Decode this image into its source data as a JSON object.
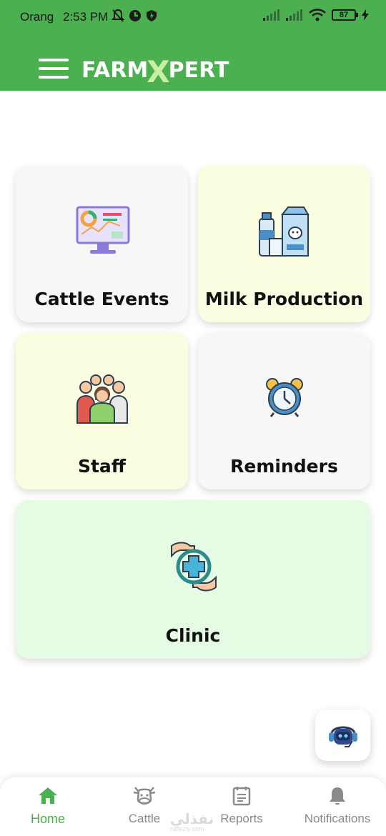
{
  "status_bar": {
    "carrier": "Orange",
    "time": "2:53 PM",
    "battery": "87"
  },
  "app_bar": {
    "logo_left": "FARM",
    "logo_x": "X",
    "logo_right": "PERT"
  },
  "cards": {
    "cattle_events": {
      "label": "Cattle Events",
      "icon": "monitor-analytics-icon"
    },
    "milk_production": {
      "label": "Milk Production",
      "icon": "milk-bottles-icon"
    },
    "staff": {
      "label": "Staff",
      "icon": "people-group-icon"
    },
    "reminders": {
      "label": "Reminders",
      "icon": "alarm-clock-icon"
    },
    "clinic": {
      "label": "Clinic",
      "icon": "medical-cross-hands-icon"
    }
  },
  "colors": {
    "brand_green": "#4caf50",
    "card_gray": "#f7f7f8",
    "card_yellow": "#fbfde0",
    "card_green": "#e6fbe3",
    "inactive_nav": "#8a8a8a"
  },
  "bottom_nav": {
    "items": [
      {
        "label": "Home",
        "icon": "home-icon",
        "active": true
      },
      {
        "label": "Cattle",
        "icon": "cow-icon",
        "active": false
      },
      {
        "label": "Reports",
        "icon": "report-icon",
        "active": false
      },
      {
        "label": "Notifications",
        "icon": "bell-icon",
        "active": false
      }
    ]
  },
  "watermark": {
    "text": "نفذلي",
    "sub": "nafezly.com"
  }
}
